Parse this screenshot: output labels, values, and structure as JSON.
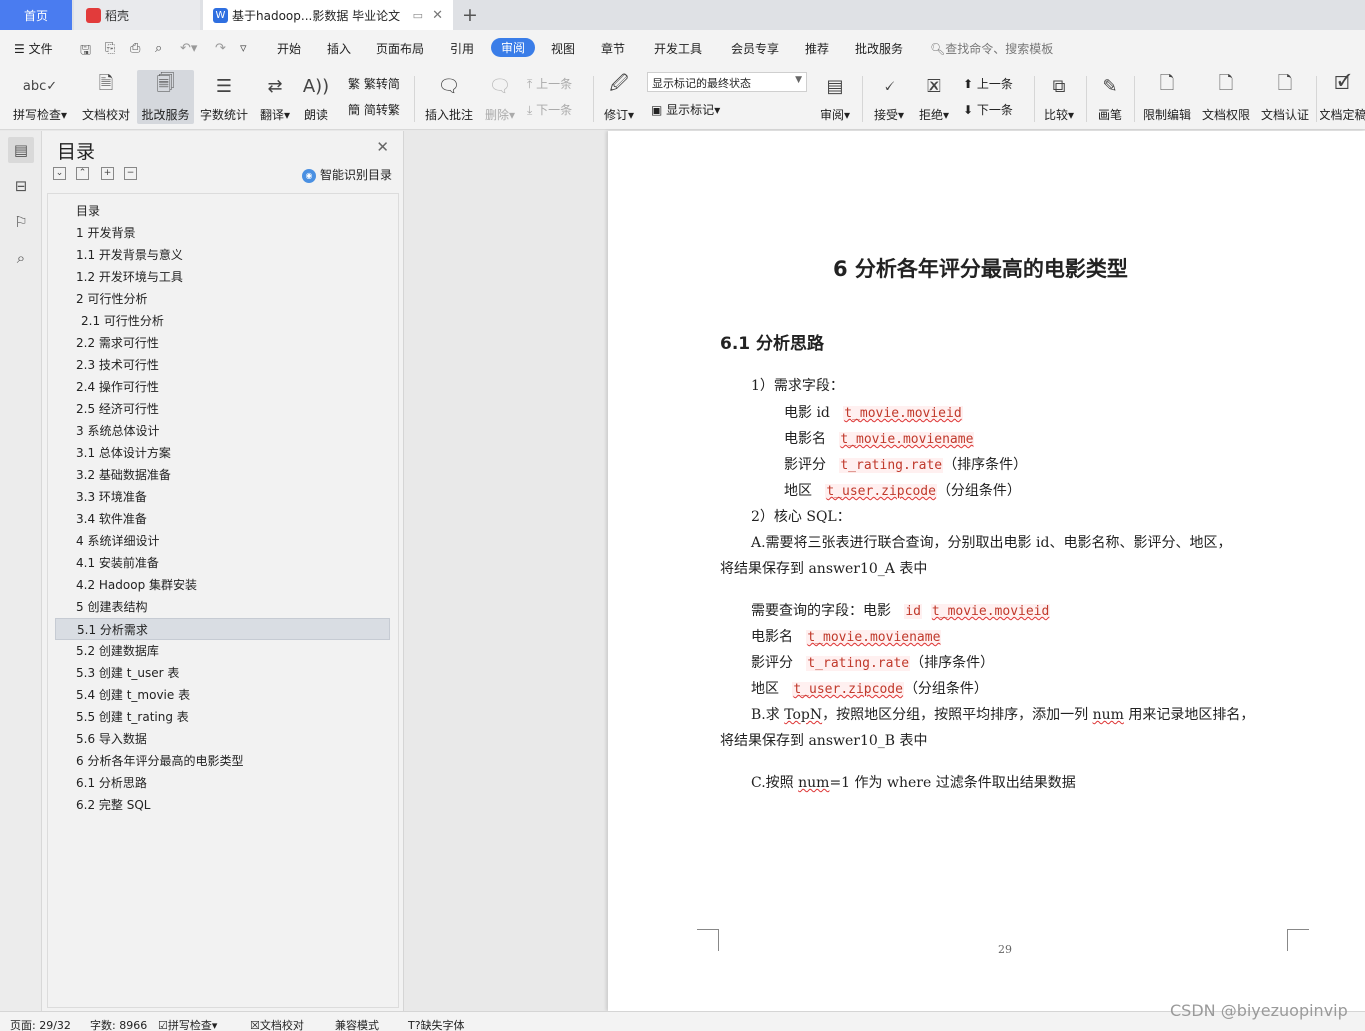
{
  "tabs": {
    "home": "首页",
    "docer": "稻壳",
    "document": "基于hadoop...影数据 毕业论文",
    "add": "+"
  },
  "menu": {
    "file": "文件",
    "items": [
      "开始",
      "插入",
      "页面布局",
      "引用",
      "审阅",
      "视图",
      "章节",
      "开发工具",
      "会员专享",
      "推荐",
      "批改服务"
    ],
    "search": "查找命令、搜索模板"
  },
  "ribbon": {
    "spell_check": "拼写检查",
    "doc_proof": "文档校对",
    "correction_service": "批改服务",
    "word_count": "字数统计",
    "translate": "翻译",
    "read_aloud": "朗读",
    "to_traditional": "繁转简",
    "to_simplified": "简转繁",
    "insert_comment": "插入批注",
    "delete": "删除",
    "prev_item": "上一条",
    "next_item": "下一条",
    "track_changes": "修订",
    "markup_state": "显示标记的最终状态",
    "show_markup": "显示标记",
    "review": "审阅",
    "accept": "接受",
    "reject": "拒绝",
    "prev_change": "上一条",
    "next_change": "下一条",
    "compare": "比较",
    "ink": "画笔",
    "restrict_edit": "限制编辑",
    "doc_permission": "文档权限",
    "doc_certify": "文档认证",
    "doc_finalize": "文档定稿"
  },
  "toc": {
    "title": "目录",
    "smart_detect": "智能识别目录",
    "items": [
      "目录",
      "1 开发背景",
      "1.1 开发背景与意义",
      "1.2 开发环境与工具",
      "2 可行性分析",
      "2.1 可行性分析",
      "2.2 需求可行性",
      "2.3 技术可行性",
      "2.4 操作可行性",
      "2.5 经济可行性",
      "3 系统总体设计",
      "3.1 总体设计方案",
      "3.2 基础数据准备",
      "3.3 环境准备",
      "3.4 软件准备",
      "4 系统详细设计",
      "4.1 安装前准备",
      "4.2 Hadoop 集群安装",
      "5 创建表结构",
      "5.1 分析需求",
      "5.2 创建数据库",
      "5.3 创建 t_user 表",
      "5.4 创建 t_movie 表",
      "5.5 创建 t_rating 表",
      "5.6 导入数据",
      "6 分析各年评分最高的电影类型",
      "6.1 分析思路",
      "6.2 完整 SQL"
    ],
    "selected": "5.1 分析需求"
  },
  "document": {
    "h1": "6 分析各年评分最高的电影类型",
    "h2": "6.1 分析思路",
    "req_title": "1）需求字段：",
    "f1_label": "电影 id",
    "f1_code": "t_movie.movieid",
    "f2_label": "电影名",
    "f2_code": "t_movie.moviename",
    "f3_label": "影评分",
    "f3_code": "t_rating.rate",
    "f3_note": "（排序条件）",
    "f4_label": "地区",
    "f4_code": "t_user.zipcode",
    "f4_note": "（分组条件）",
    "sql_title": "2）核心 SQL：",
    "a_line1": "A.需要将三张表进行联合查询，分别取出电影 id、电影名称、影评分、地区，",
    "a_line2": "将结果保存到 answer10_A 表中",
    "q_prefix": "需要查询的字段：电影",
    "q_id": "id",
    "q_code1": "t_movie.movieid",
    "q2_label": "电影名",
    "q2_code": "t_movie.moviename",
    "q3_label": "影评分",
    "q3_code": "t_rating.rate",
    "q3_note": "（排序条件）",
    "q4_label": "地区",
    "q4_code": "t_user.zipcode",
    "q4_note": "（分组条件）",
    "b_pre": "B.求 ",
    "b_topn": "TopN",
    "b_mid": "，按照地区分组，按照平均排序，添加一列 ",
    "b_num": "num",
    "b_post": " 用来记录地区排名，",
    "b_line2": "将结果保存到 answer10_B 表中",
    "c_pre": "C.按照 ",
    "c_num": "num",
    "c_post": "=1 作为 where 过滤条件取出结果数据",
    "page_number": "29"
  },
  "status": {
    "page": "页面: 29/32",
    "word_count": "字数: 8966",
    "spell_check": "拼写检查",
    "doc_proof": "文档校对",
    "compat_mode": "兼容模式",
    "missing_font": "缺失字体"
  },
  "watermark": "CSDN @biyezuopinvip",
  "colors": {
    "accent": "#3a7de8",
    "home_tab": "#4a7cf0",
    "code": "#c0392b"
  }
}
